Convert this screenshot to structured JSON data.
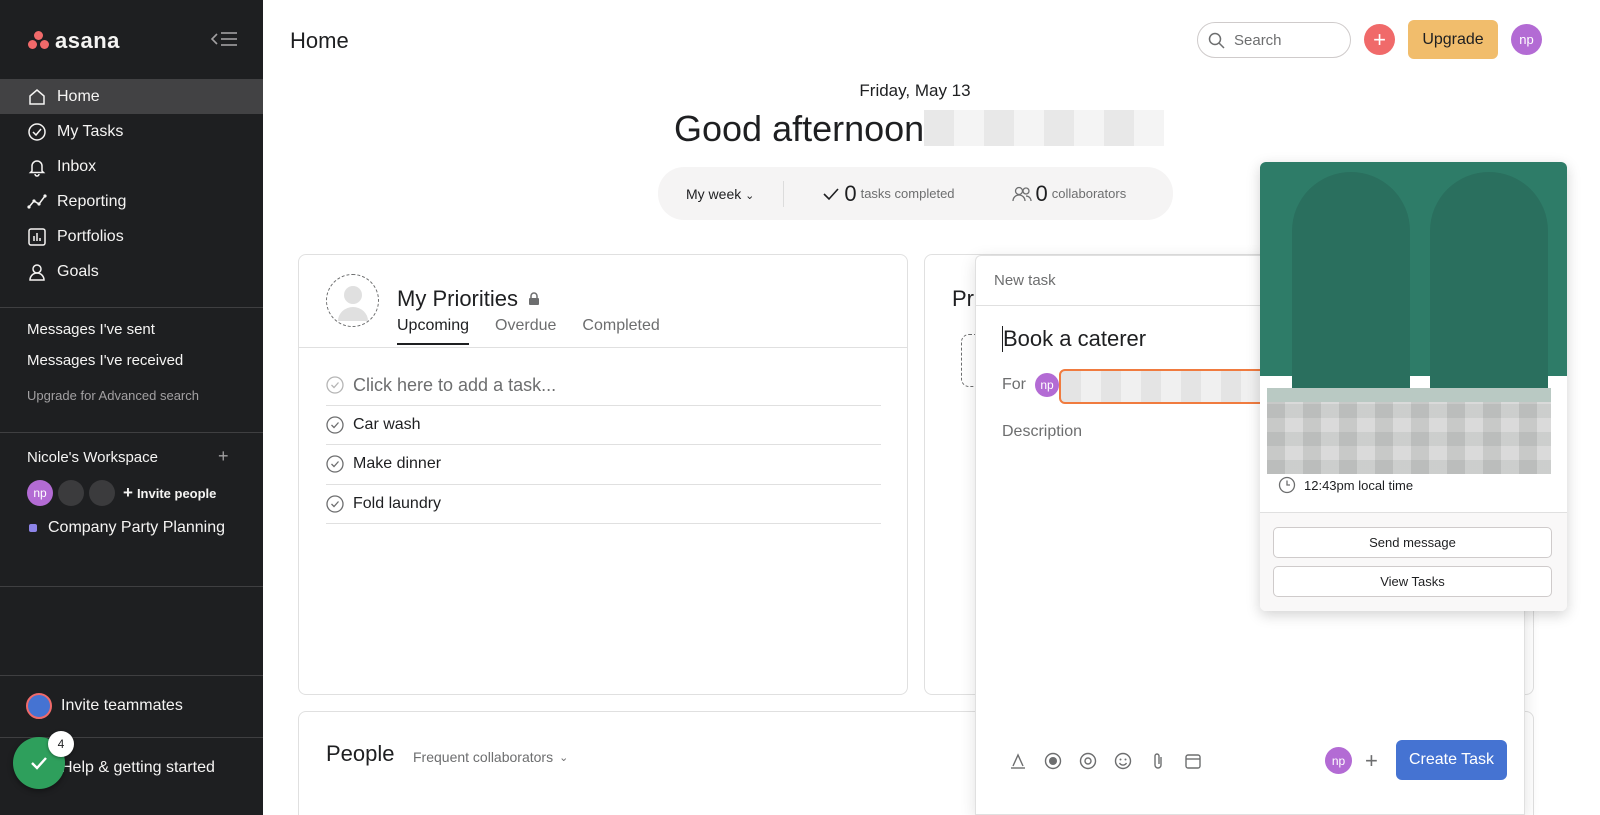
{
  "sidebar": {
    "logo_text": "asana",
    "nav": [
      {
        "label": "Home",
        "icon": "home-icon"
      },
      {
        "label": "My Tasks",
        "icon": "check-circle-icon"
      },
      {
        "label": "Inbox",
        "icon": "bell-icon"
      },
      {
        "label": "Reporting",
        "icon": "line-chart-icon"
      },
      {
        "label": "Portfolios",
        "icon": "bar-chart-icon"
      },
      {
        "label": "Goals",
        "icon": "person-icon"
      }
    ],
    "messages_sent": "Messages I've sent",
    "messages_received": "Messages I've received",
    "upgrade_search": "Upgrade for Advanced search",
    "workspace": {
      "title": "Nicole's Workspace",
      "avatar_initials": "np",
      "invite_people": "Invite people",
      "project": "Company Party Planning"
    },
    "invite_teammates": "Invite teammates",
    "help": "Help & getting started",
    "help_badge": "4"
  },
  "topbar": {
    "title": "Home",
    "search_placeholder": "Search",
    "upgrade": "Upgrade",
    "avatar_initials": "np"
  },
  "greeting": {
    "date": "Friday, May 13",
    "text": "Good afternoon,"
  },
  "stats": {
    "range": "My week",
    "tasks_count": "0",
    "tasks_label": "tasks completed",
    "collab_count": "0",
    "collab_label": "collaborators"
  },
  "priorities": {
    "title": "My Priorities",
    "tabs": [
      "Upcoming",
      "Overdue",
      "Completed"
    ],
    "add_task": "Click here to add a task...",
    "tasks": [
      "Car wash",
      "Make dinner",
      "Fold laundry"
    ]
  },
  "projects_card": {
    "title_partial": "Pr"
  },
  "people": {
    "title": "People",
    "filter": "Frequent collaborators"
  },
  "new_task": {
    "header": "New task",
    "title": "Book a caterer",
    "for_label": "For",
    "assignee_initials": "np",
    "description_placeholder": "Description",
    "footer_avatar": "np",
    "create": "Create Task"
  },
  "profile_card": {
    "local_time": "12:43pm local time",
    "send_message": "Send message",
    "view_tasks": "View Tasks",
    "colors": {
      "banner": "#2e7c68"
    }
  },
  "colors": {
    "sidebar_bg": "#1e1f21",
    "accent_coral": "#f06a6a",
    "upgrade_yellow": "#f1bd6c",
    "primary_blue": "#4573d2",
    "avatar_purple": "#b36bd4",
    "highlight_orange": "#f07b3f"
  }
}
